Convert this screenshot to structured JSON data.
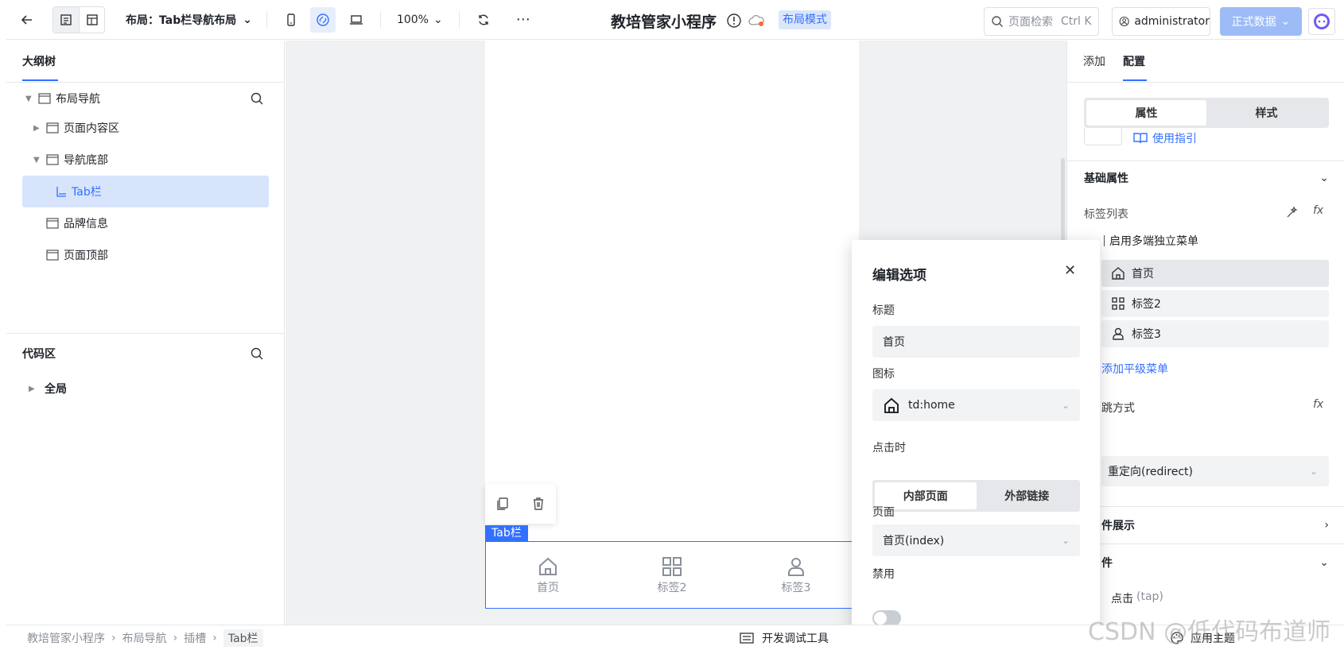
{
  "topbar": {
    "layout_title": "布局：Tab栏导航布局",
    "zoom": "100%",
    "app_title": "教培管家小程序",
    "mode_badge": "布局模式",
    "search_placeholder": "页面检索",
    "search_shortcut": "Ctrl K",
    "user": "administrator",
    "data_button": "正式数据"
  },
  "left": {
    "tab": "大纲树",
    "tree": [
      {
        "label": "布局导航"
      },
      {
        "label": "页面内容区"
      },
      {
        "label": "导航底部"
      },
      {
        "label": "Tab栏"
      },
      {
        "label": "品牌信息"
      },
      {
        "label": "页面顶部"
      }
    ],
    "code_title": "代码区",
    "code_item": "全局"
  },
  "canvas": {
    "tab_label": "Tab栏",
    "tabs": [
      {
        "label": "首页",
        "icon": "home-icon"
      },
      {
        "label": "标签2",
        "icon": "grid-icon"
      },
      {
        "label": "标签3",
        "icon": "user-icon"
      }
    ]
  },
  "popup": {
    "title": "编辑选项",
    "title_label": "标题",
    "title_value": "首页",
    "icon_label": "图标",
    "icon_value": "td:home",
    "click_label": "点击时",
    "seg_internal": "内部页面",
    "seg_external": "外部链接",
    "page_label": "页面",
    "page_value": "首页(index)",
    "disable_label": "禁用"
  },
  "right": {
    "tab_add": "添加",
    "tab_config": "配置",
    "seg_attr": "属性",
    "seg_style": "样式",
    "guide": "使用指引",
    "basic": "基础属性",
    "tag_list": "标签列表",
    "multi_menu": "启用多端独立菜单",
    "items": [
      {
        "label": "首页"
      },
      {
        "label": "标签2"
      },
      {
        "label": "标签3"
      }
    ],
    "add_menu": "添加平级菜单",
    "nav_mode": "跳方式",
    "nav_value": "重定向(redirect)",
    "section2": "件展示",
    "section3": "件",
    "event": "点击",
    "event_code": "(tap)",
    "apply_theme": "应用主题"
  },
  "bottom": {
    "crumbs": [
      "教培管家小程序",
      "布局导航",
      "插槽",
      "Tab栏"
    ],
    "dev_tools": "开发调试工具"
  },
  "watermark": "CSDN @低代码布道师",
  "colors": {
    "accent": "#3370ff",
    "selected": "#d7e4fb"
  }
}
